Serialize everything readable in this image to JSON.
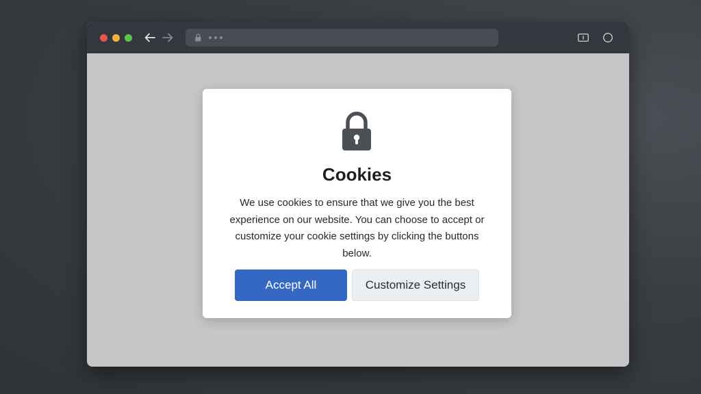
{
  "browser": {
    "icons": {
      "back": "arrow-left-icon",
      "forward": "arrow-right-icon",
      "lock": "lock-icon",
      "sidebar": "sidebar-icon",
      "profile": "circle-icon"
    }
  },
  "modal": {
    "icon": "lock-icon",
    "title": "Cookies",
    "message": "We use cookies to ensure that we give you the best experience on our website. You can choose to accept or customize your cookie settings by clicking the buttons below.",
    "accept_label": "Accept All",
    "customize_label": "Customize Settings"
  },
  "colors": {
    "accent": "#3468c2",
    "titlebar": "#34383e",
    "overlay": "#c6c6c6"
  }
}
